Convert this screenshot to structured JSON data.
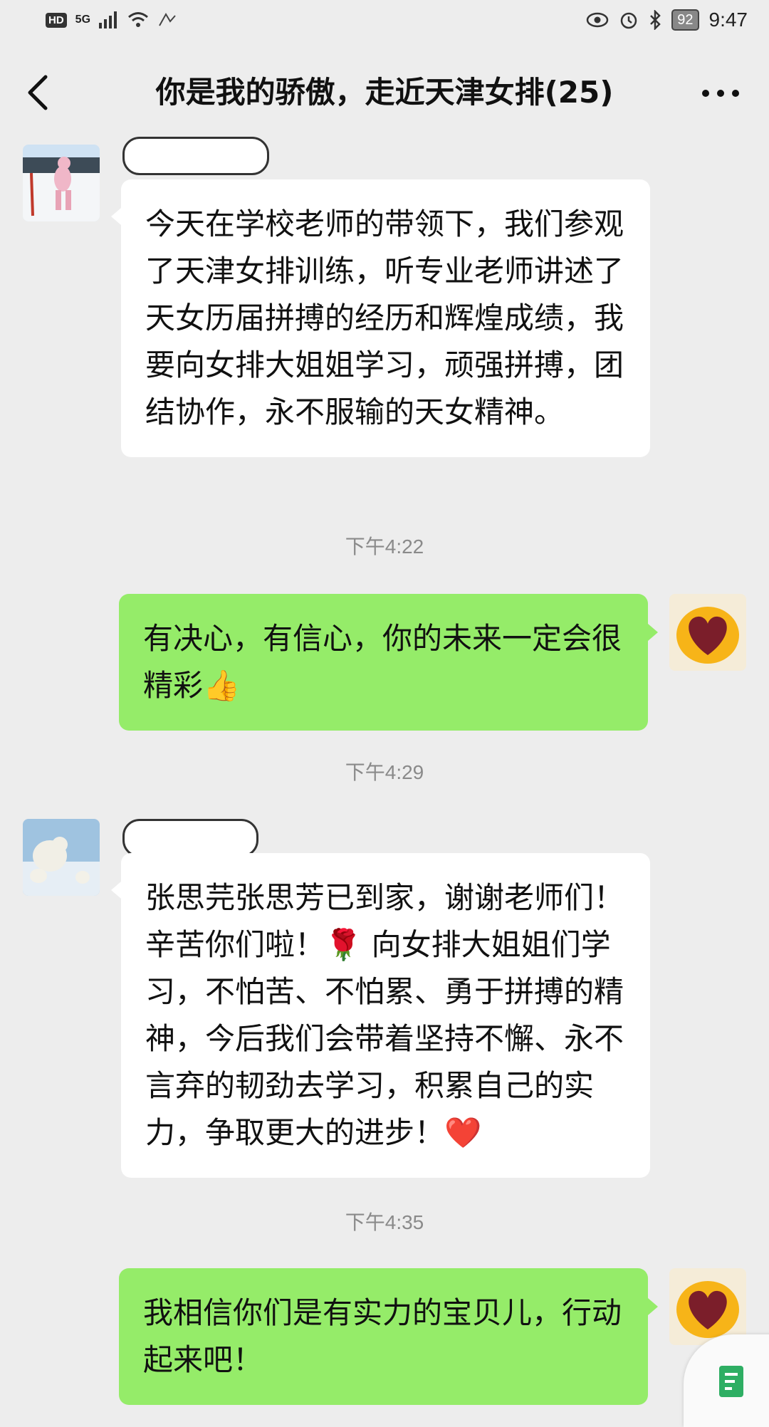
{
  "status_bar": {
    "hd_badge": "HD",
    "network": "5G",
    "battery": "92",
    "time": "9:47"
  },
  "header": {
    "title": "你是我的骄傲，走近天津女排(25)"
  },
  "messages": [
    {
      "direction": "incoming",
      "text": "今天在学校老师的带领下，我们参观了天津女排训练，听专业老师讲述了天女历届拼搏的经历和辉煌成绩，我要向女排大姐姐学习，顽强拼搏，团结协作，永不服输的天女精神。"
    },
    {
      "timestamp": "下午4:22"
    },
    {
      "direction": "outgoing",
      "text": "有决心，有信心，你的未来一定会很精彩👍"
    },
    {
      "timestamp": "下午4:29"
    },
    {
      "direction": "incoming",
      "text": "张思芫张思芳已到家，谢谢老师们！辛苦你们啦！🌹 向女排大姐姐们学习，不怕苦、不怕累、勇于拼搏的精神，今后我们会带着坚持不懈、永不言弃的韧劲去学习，积累自己的实力，争取更大的进步！❤️"
    },
    {
      "timestamp": "下午4:35"
    },
    {
      "direction": "outgoing",
      "text": "我相信你们是有实力的宝贝儿，行动起来吧！"
    }
  ],
  "colors": {
    "background": "#ededed",
    "incoming_bubble": "#ffffff",
    "outgoing_bubble": "#95ec69",
    "timestamp": "#8a8a8a"
  },
  "icons": {
    "back": "chevron-left-icon",
    "more": "more-dots-icon",
    "float": "note-icon"
  }
}
